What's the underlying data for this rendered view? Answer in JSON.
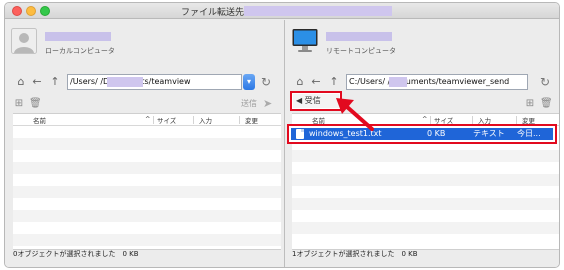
{
  "window": {
    "title": "ファイル転送先"
  },
  "left": {
    "computer_type": "ローカルコンピュータ",
    "path": "/Users/           /Documents/teamview",
    "send_label": "送信",
    "columns": [
      "名前",
      "サイズ",
      "入力",
      "変更"
    ],
    "status": "0オブジェクトが選択されました　0 KB"
  },
  "right": {
    "computer_type": "リモートコンピュータ",
    "path": "C:/Users/        /Documents/teamviewer_send",
    "receive_label": "受信",
    "columns": [
      "名前",
      "サイズ",
      "入力",
      "変更"
    ],
    "file": {
      "name": "windows_test1.txt",
      "size": "0 KB",
      "type": "テキスト",
      "modified": "今日..."
    },
    "status": "1オブジェクトが選択されました　0 KB"
  },
  "colors": {
    "highlight": "#e20a1f",
    "selection": "#1f65d8",
    "redaction": "#cfc6ee"
  }
}
